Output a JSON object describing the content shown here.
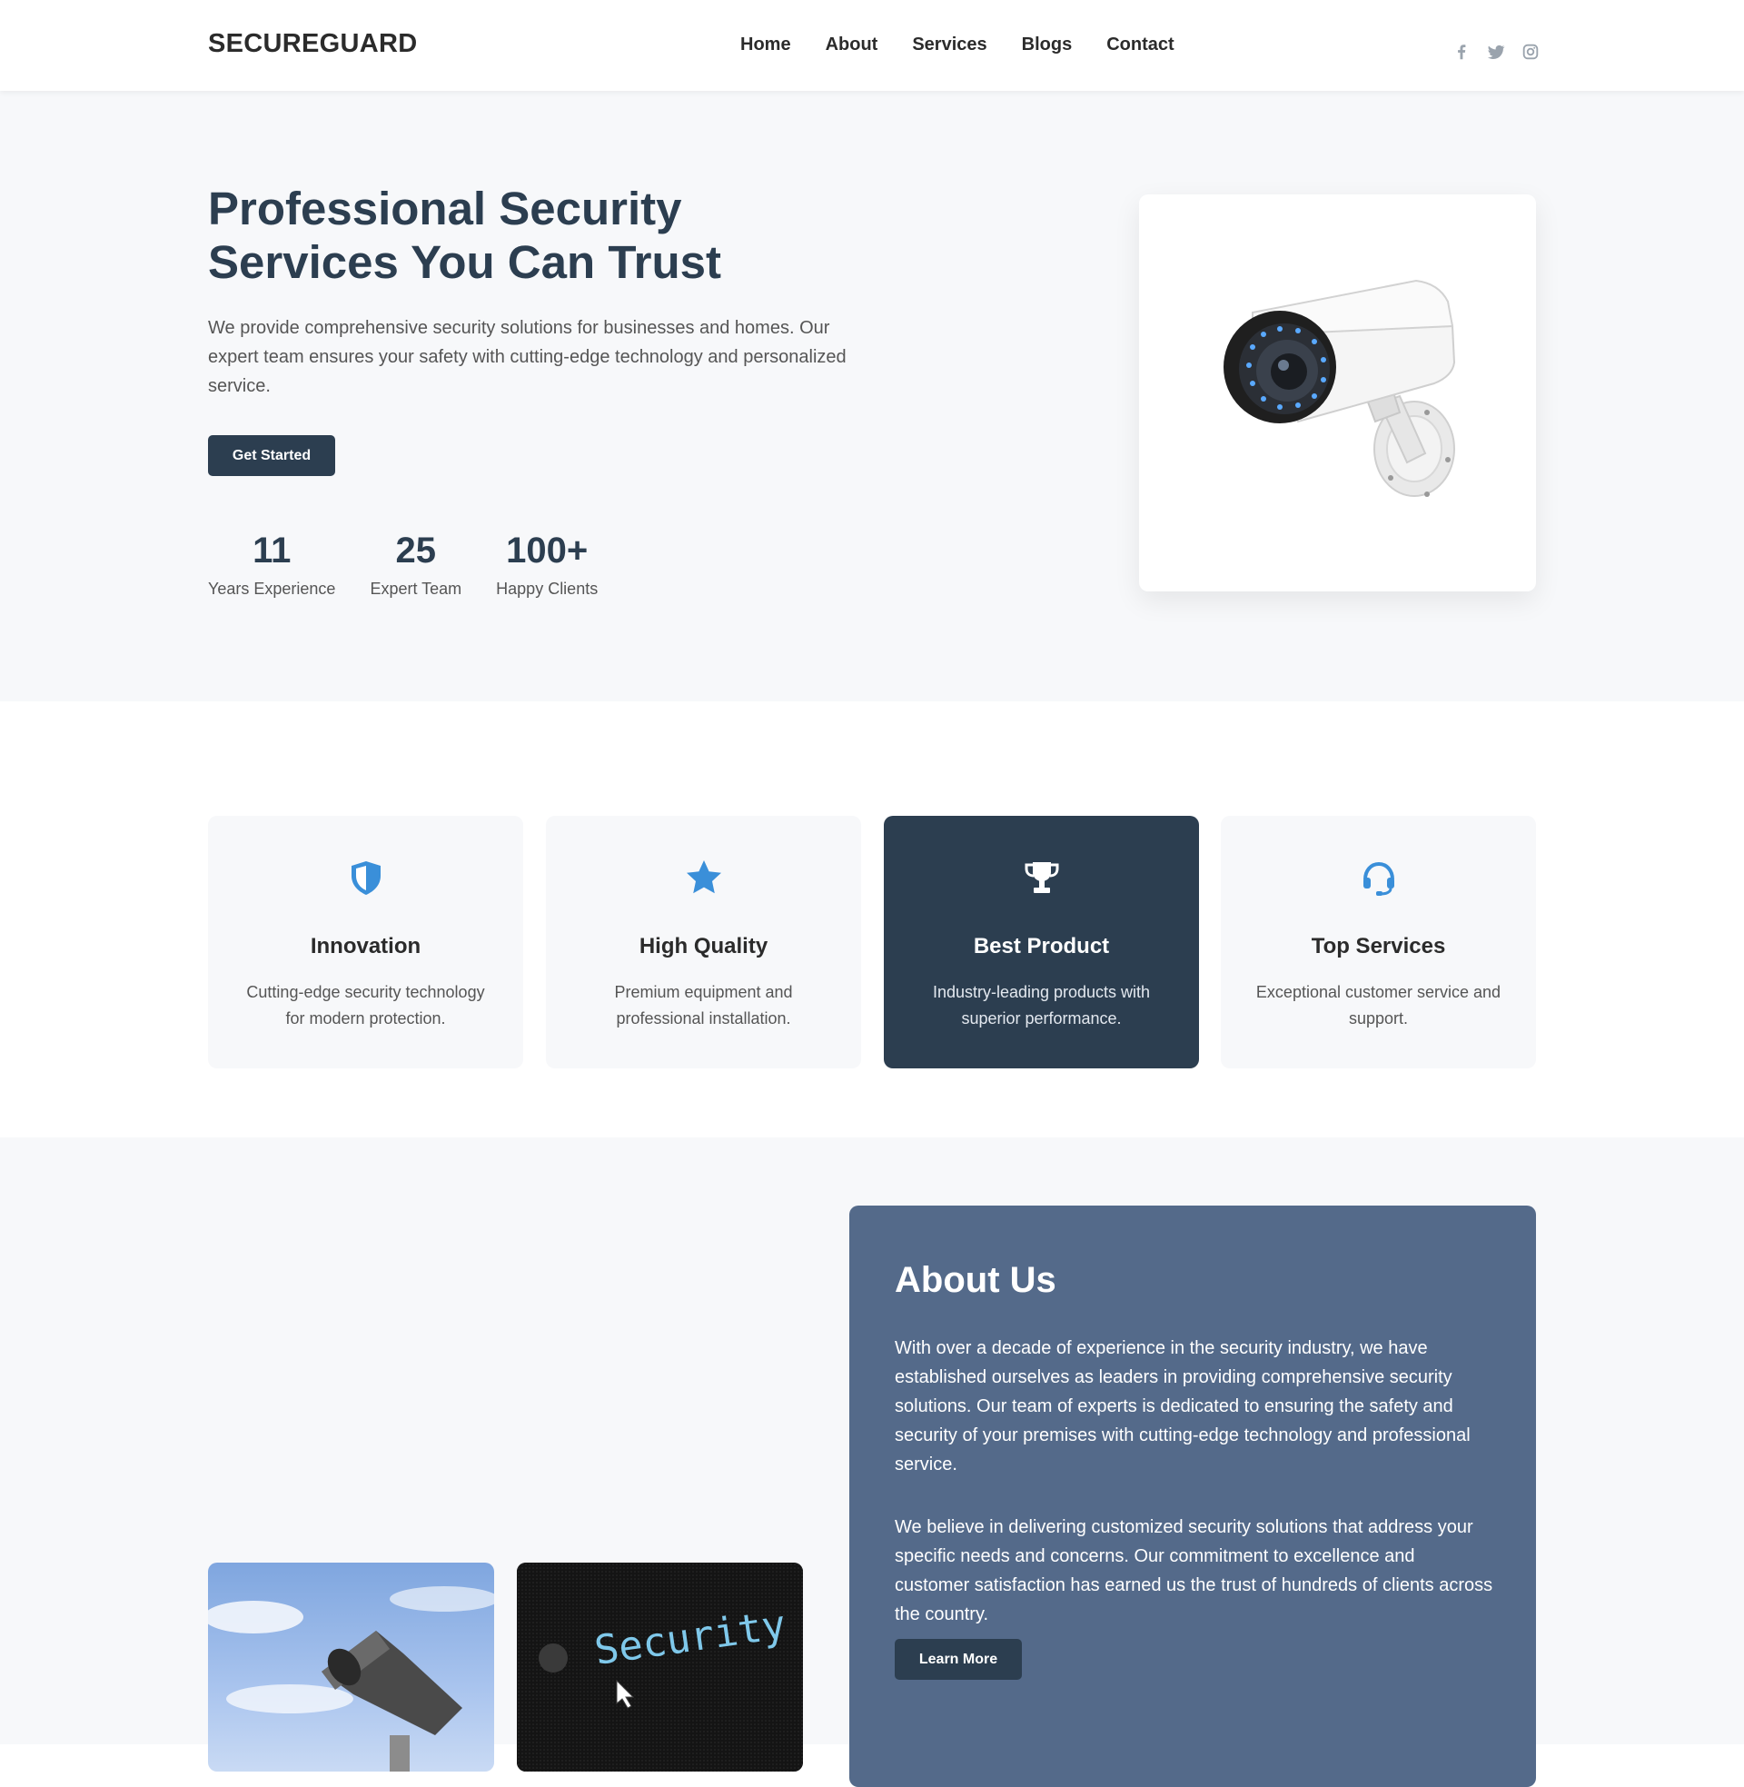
{
  "header": {
    "logo": "SECUREGUARD",
    "nav": [
      "Home",
      "About",
      "Services",
      "Blogs",
      "Contact"
    ],
    "social_icons": [
      "facebook-icon",
      "twitter-icon",
      "instagram-icon"
    ]
  },
  "hero": {
    "title": "Professional Security Services You Can Trust",
    "description": "We provide comprehensive security solutions for businesses and homes. Our expert team ensures your safety with cutting-edge technology and personalized service.",
    "cta_label": "Get Started",
    "stats": [
      {
        "value": "11",
        "label": "Years Experience"
      },
      {
        "value": "25",
        "label": "Expert Team"
      },
      {
        "value": "100+",
        "label": "Happy Clients"
      }
    ],
    "image_icon": "security-camera-image"
  },
  "features": [
    {
      "icon": "shield-icon",
      "title": "Innovation",
      "text": "Cutting-edge security technology for modern protection."
    },
    {
      "icon": "star-icon",
      "title": "High Quality",
      "text": "Premium equipment and professional installation."
    },
    {
      "icon": "trophy-icon",
      "title": "Best Product",
      "text": "Industry-leading products with superior performance."
    },
    {
      "icon": "headset-icon",
      "title": "Top Services",
      "text": "Exceptional customer service and support."
    }
  ],
  "about": {
    "title": "About Us",
    "paragraph1": "With over a decade of experience in the security industry, we have established ourselves as leaders in providing comprehensive security solutions. Our team of experts is dedicated to ensuring the safety and security of your premises with cutting-edge technology and professional service.",
    "paragraph2": "We believe in delivering customized security solutions that address your specific needs and concerns. Our commitment to excellence and customer satisfaction has earned us the trust of hundreds of clients across the country.",
    "cta_label": "Learn More",
    "image_text": "Security"
  },
  "colors": {
    "primary": "#2c3e50",
    "accent": "#3a8fd9",
    "about_bg": "#546a8a",
    "section_bg": "#f7f8fa"
  }
}
